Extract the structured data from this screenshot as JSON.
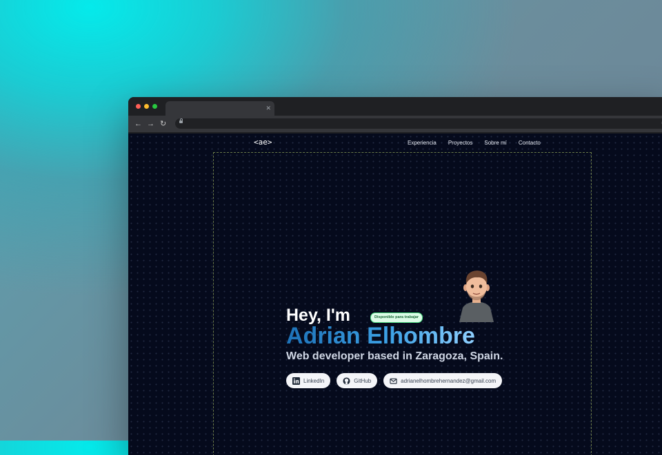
{
  "site": {
    "logo": "<ae>",
    "nav": [
      "Experiencia",
      "Proyectos",
      "Sobre mí",
      "Contacto"
    ]
  },
  "hero": {
    "greeting": "Hey, I'm",
    "badge": "Disponible para trabajar",
    "name": "Adrian Elhombre",
    "subtitle": "Web developer based in Zaragoza, Spain.",
    "links": [
      {
        "label": "LinkedIn",
        "icon": "linkedin-icon"
      },
      {
        "label": "GitHub",
        "icon": "github-icon"
      },
      {
        "label": "adrianelhombrehernandez@gmail.com",
        "icon": "mail-icon"
      }
    ]
  },
  "colors": {
    "page_bg": "#050a1c",
    "name_gradient_start": "#1d72b8",
    "name_gradient_end": "#8fd0ff",
    "badge_bg": "#dcfce7",
    "badge_text": "#166534"
  }
}
